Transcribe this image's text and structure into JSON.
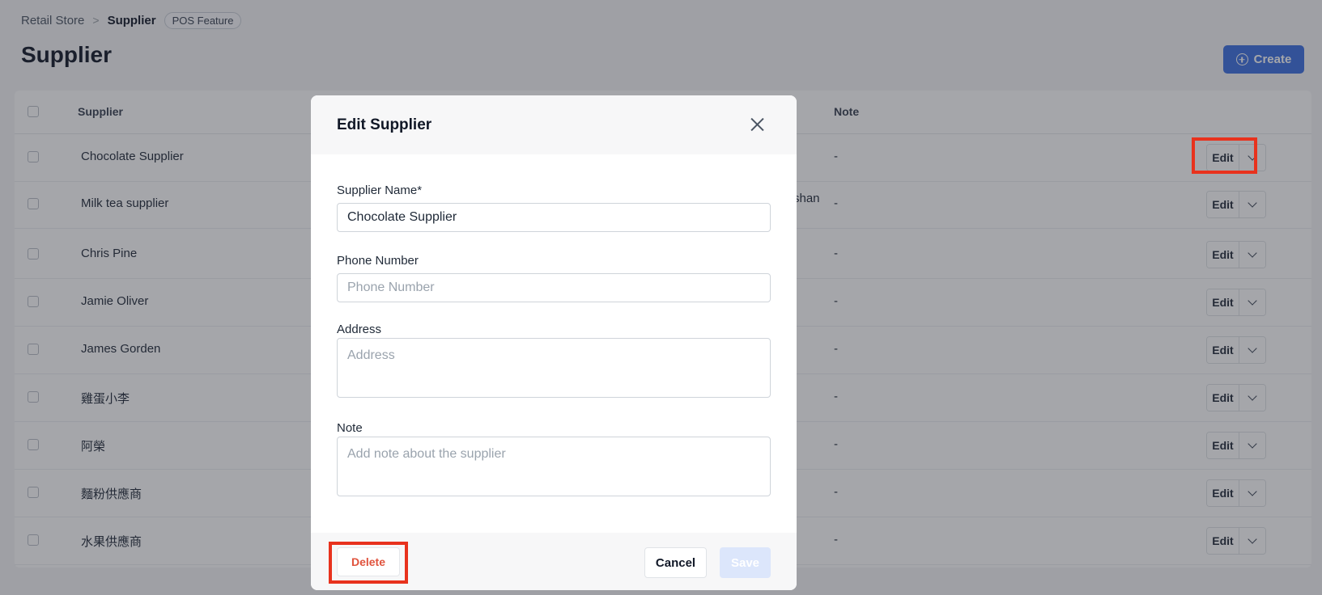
{
  "breadcrumb": {
    "root": "Retail Store",
    "separator": ">",
    "current": "Supplier",
    "badge": "POS Feature"
  },
  "page": {
    "title": "Supplier",
    "create_label": "Create"
  },
  "table": {
    "columns": {
      "supplier": "Supplier",
      "note": "Note"
    },
    "row_fragment": "shan",
    "rows": [
      {
        "name": "Chocolate Supplier",
        "note": "-",
        "edit_label": "Edit"
      },
      {
        "name": "Milk tea supplier",
        "note": "-",
        "edit_label": "Edit"
      },
      {
        "name": "Chris Pine",
        "note": "-",
        "edit_label": "Edit"
      },
      {
        "name": "Jamie Oliver",
        "note": "-",
        "edit_label": "Edit"
      },
      {
        "name": "James Gorden",
        "note": "-",
        "edit_label": "Edit"
      },
      {
        "name": "雞蛋小李",
        "note": "-",
        "edit_label": "Edit"
      },
      {
        "name": "阿榮",
        "note": "-",
        "edit_label": "Edit"
      },
      {
        "name": "麵粉供應商",
        "note": "-",
        "edit_label": "Edit"
      },
      {
        "name": "水果供應商",
        "note": "-",
        "edit_label": "Edit"
      }
    ]
  },
  "modal": {
    "title": "Edit Supplier",
    "fields": {
      "name": {
        "label": "Supplier Name*",
        "value": "Chocolate Supplier",
        "placeholder": ""
      },
      "phone": {
        "label": "Phone Number",
        "value": "",
        "placeholder": "Phone Number"
      },
      "address": {
        "label": "Address",
        "value": "",
        "placeholder": "Address"
      },
      "note": {
        "label": "Note",
        "value": "",
        "placeholder": "Add note about the supplier"
      }
    },
    "delete_label": "Delete",
    "cancel_label": "Cancel",
    "save_label": "Save"
  },
  "colors": {
    "primary": "#3b6fe0",
    "danger": "#e0533d",
    "highlight": "#e8321d",
    "save_disabled": "#dce6fb"
  }
}
